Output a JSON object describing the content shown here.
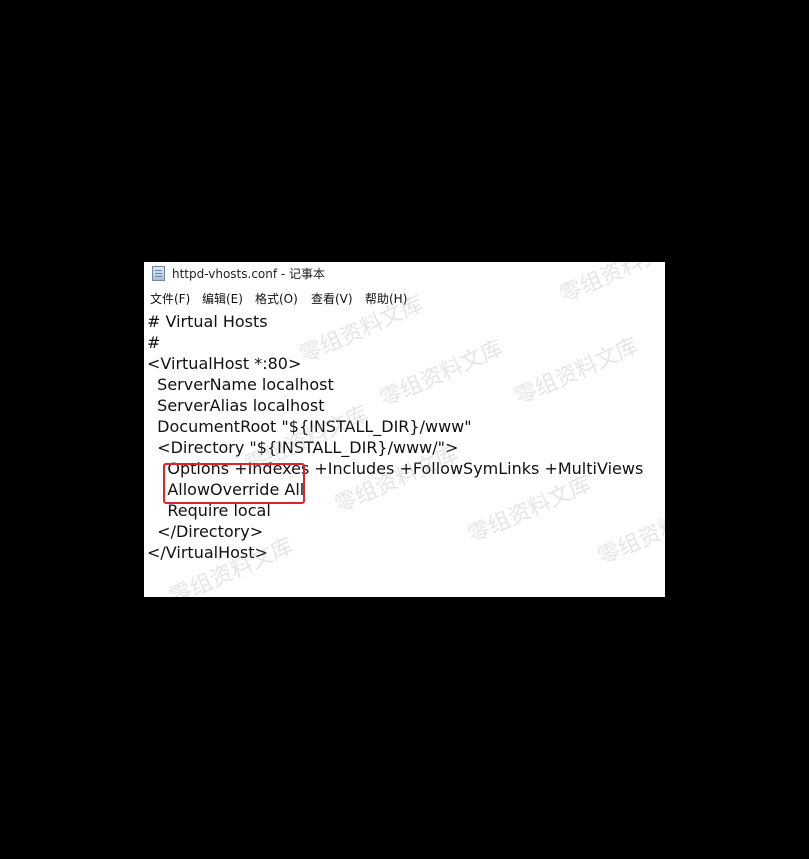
{
  "window": {
    "title": "httpd-vhosts.conf - 记事本",
    "icon": "notepad-icon"
  },
  "menu": {
    "items": [
      "文件(F)",
      "编辑(E)",
      "格式(O)",
      "查看(V)",
      "帮助(H)"
    ]
  },
  "editor": {
    "lines": [
      "# Virtual Hosts",
      "#",
      "<VirtualHost *:80>",
      "  ServerName localhost",
      "  ServerAlias localhost",
      "  DocumentRoot \"${INSTALL_DIR}/www\"",
      "  <Directory \"${INSTALL_DIR}/www/\">",
      "    Options +Indexes +Includes +FollowSymLinks +MultiViews",
      "    AllowOverride All",
      "    Require local",
      "  </Directory>",
      "</VirtualHost>"
    ],
    "highlight_color": "#d8262b"
  },
  "watermark": {
    "text": "零组资料文库"
  }
}
